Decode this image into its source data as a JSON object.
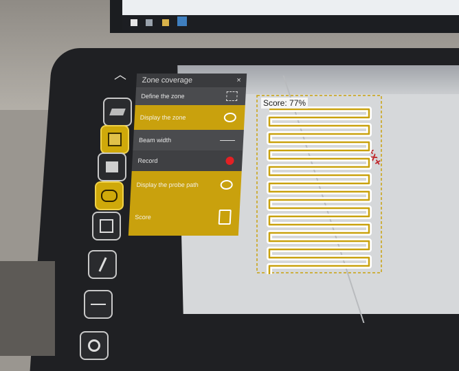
{
  "panel": {
    "title": "Zone coverage",
    "close": "×",
    "rows": [
      {
        "label": "Define the zone",
        "icon": "square-outline-icon"
      },
      {
        "label": "Display the zone",
        "icon": "eye-icon"
      },
      {
        "label": "Beam width",
        "icon": "double-arrow-icon"
      },
      {
        "label": "Record",
        "icon": "red-dot-icon"
      },
      {
        "label": "Display the probe path",
        "icon": "eye-icon"
      },
      {
        "label": "Score",
        "icon": "clipboard-icon"
      }
    ]
  },
  "score_label": "Score: 77%",
  "weld_mark": "+x+",
  "colors": {
    "accent": "#cfa90a",
    "record": "#e32024",
    "dark": "#2a2b2e"
  }
}
